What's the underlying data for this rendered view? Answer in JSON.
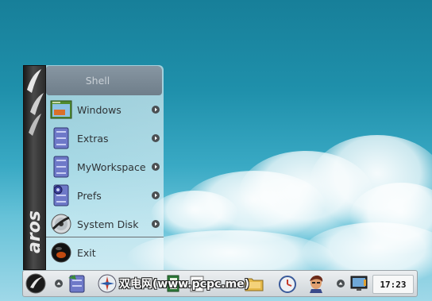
{
  "start_menu": {
    "brand": "aros",
    "items": [
      {
        "label": "Shell",
        "icon": "shell-icon",
        "submenu": false
      },
      {
        "label": "Windows",
        "icon": "windows-folder-icon",
        "submenu": true
      },
      {
        "label": "Extras",
        "icon": "extras-drawer-icon",
        "submenu": true
      },
      {
        "label": "MyWorkspace",
        "icon": "workspace-drawer-icon",
        "submenu": true
      },
      {
        "label": "Prefs",
        "icon": "prefs-drawer-icon",
        "submenu": true
      },
      {
        "label": "System Disk",
        "icon": "system-disk-icon",
        "submenu": true
      },
      {
        "label": "Exit",
        "icon": "exit-icon",
        "submenu": false
      }
    ]
  },
  "taskbar": {
    "clock": "17:23",
    "icons": [
      "aros-start-icon",
      "drawer-icon",
      "browser-icon",
      "editor-icon",
      "documents-icon",
      "folder-icon",
      "clock-app-icon",
      "avatar-icon",
      "monitor-icon"
    ]
  },
  "watermark": "双电网(www.pcpc.me)",
  "colors": {
    "sky_top": "#177f99",
    "menu_highlight": "#7a8995",
    "taskbar": "#dde2e5"
  }
}
